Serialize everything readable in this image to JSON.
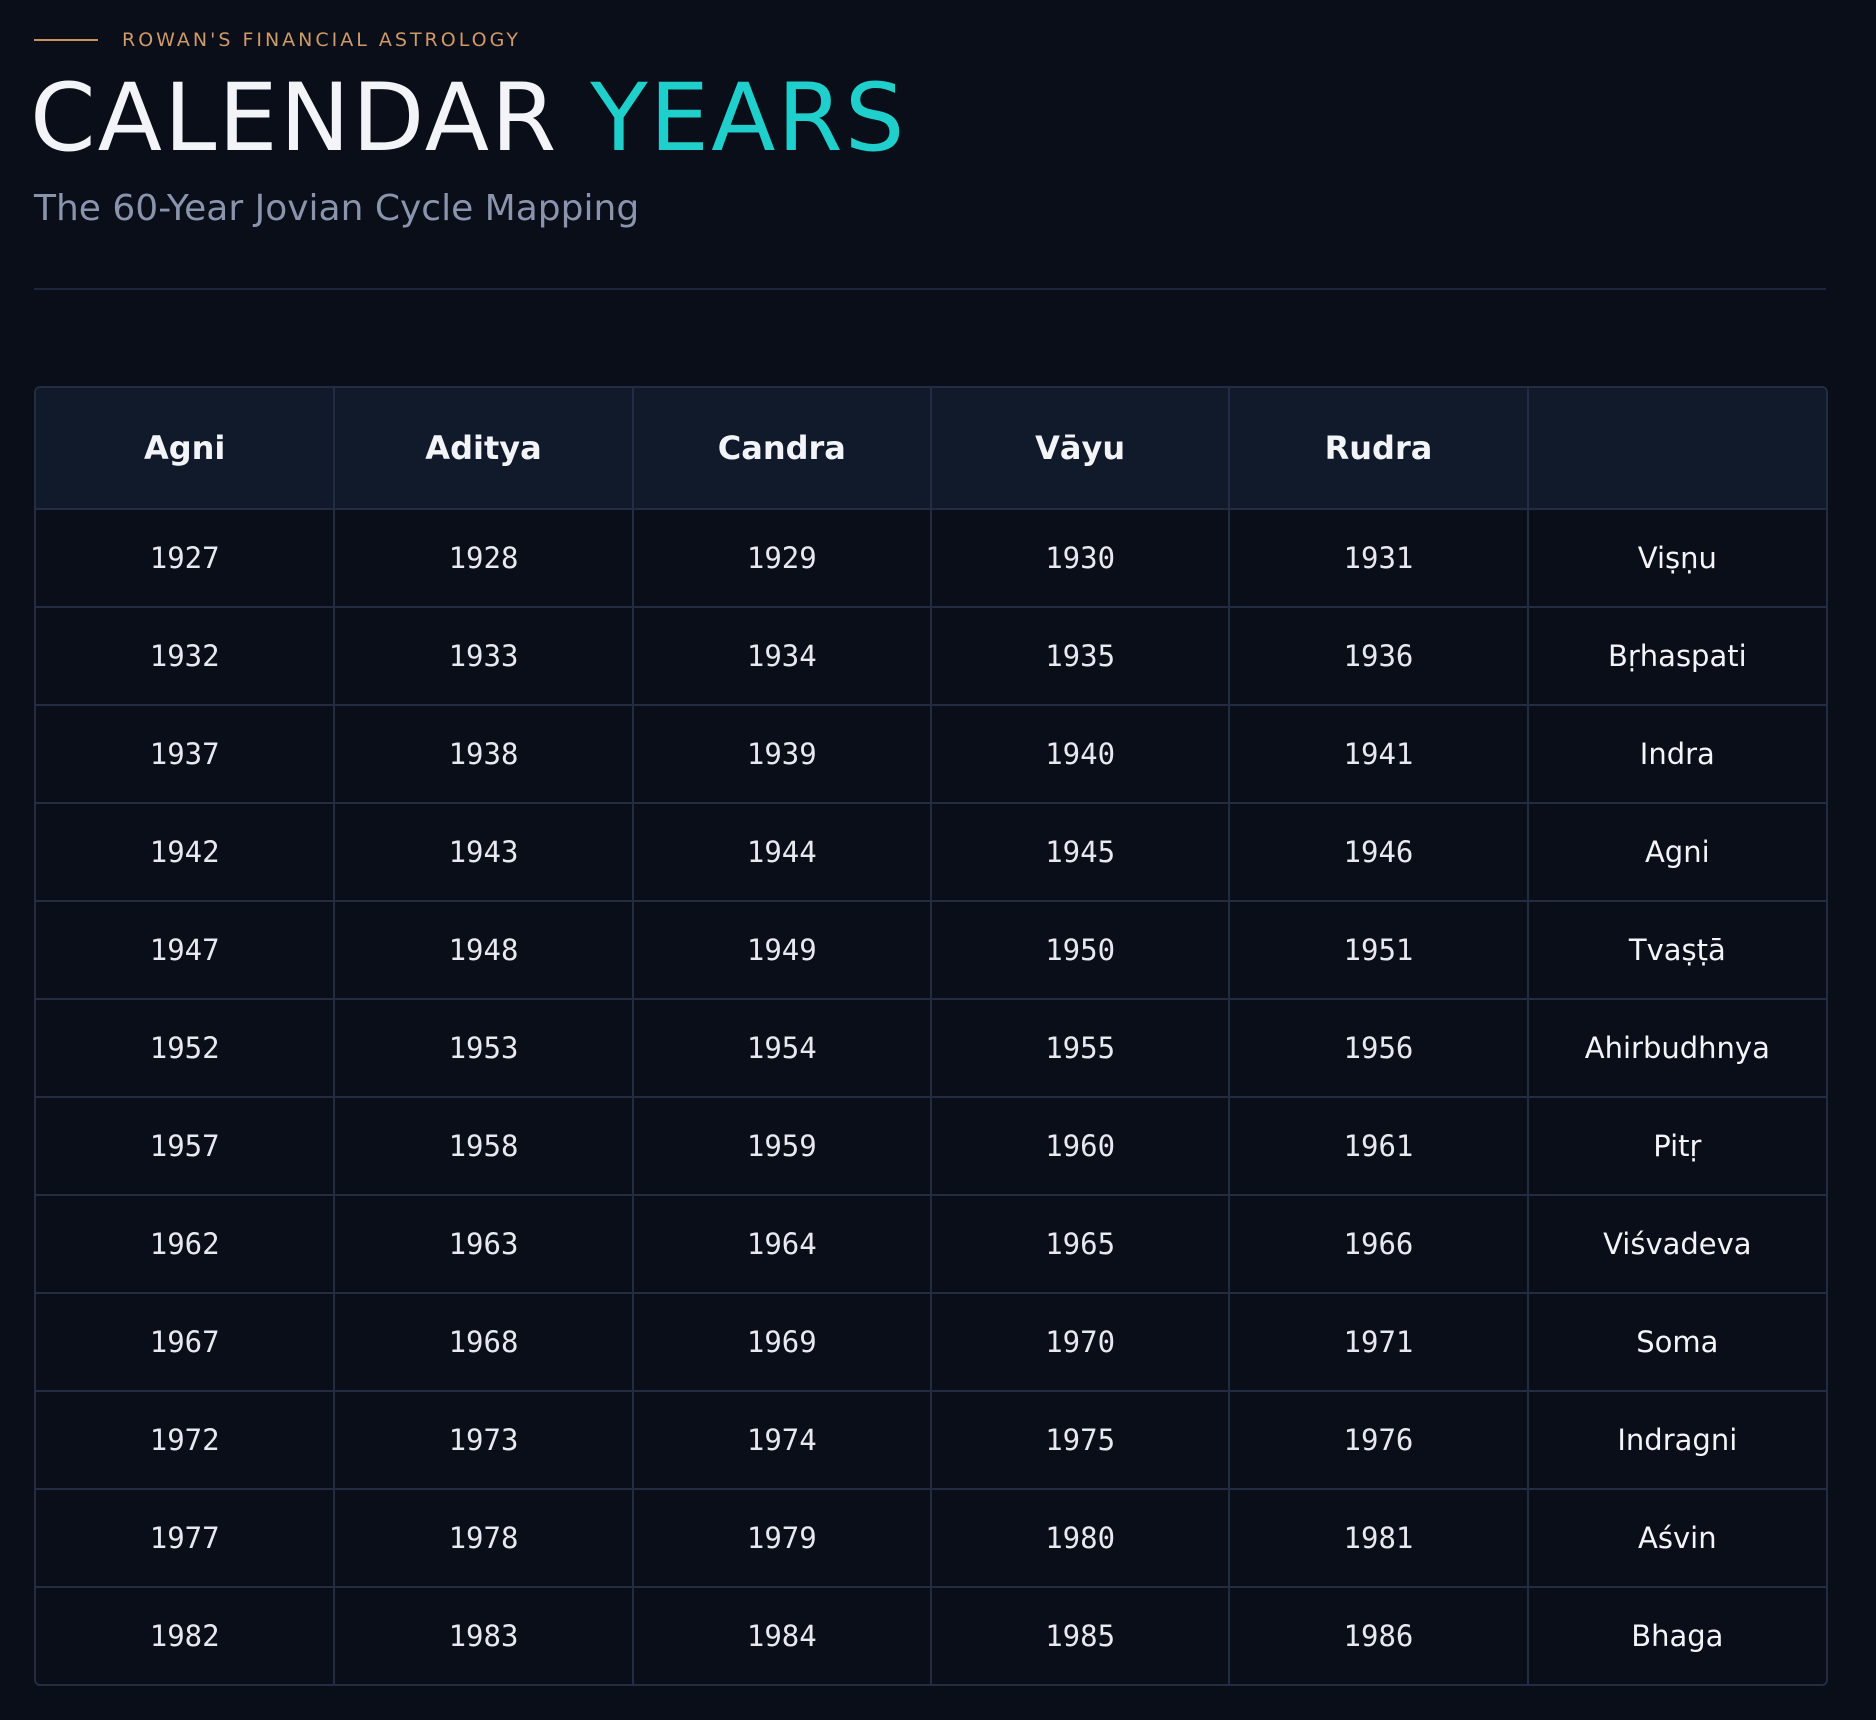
{
  "header": {
    "eyebrow": "ROWAN'S FINANCIAL ASTROLOGY",
    "title_main": "CALENDAR",
    "title_accent": "YEARS",
    "subtitle": "The 60-Year Jovian Cycle Mapping"
  },
  "colors": {
    "background": "#0a0e19",
    "accent": "#1fcfcb",
    "eyebrow": "#cf9a68",
    "subtitle": "#8a94ad",
    "grid": "#222c42",
    "header_row": "#111a2b"
  },
  "table": {
    "columns": [
      "Agni",
      "Aditya",
      "Candra",
      "Vāyu",
      "Rudra",
      ""
    ],
    "rows": [
      [
        "1927",
        "1928",
        "1929",
        "1930",
        "1931",
        "Viṣṇu"
      ],
      [
        "1932",
        "1933",
        "1934",
        "1935",
        "1936",
        "Bṛhaspati"
      ],
      [
        "1937",
        "1938",
        "1939",
        "1940",
        "1941",
        "Indra"
      ],
      [
        "1942",
        "1943",
        "1944",
        "1945",
        "1946",
        "Agni"
      ],
      [
        "1947",
        "1948",
        "1949",
        "1950",
        "1951",
        "Tvaṣṭā"
      ],
      [
        "1952",
        "1953",
        "1954",
        "1955",
        "1956",
        "Ahirbudhnya"
      ],
      [
        "1957",
        "1958",
        "1959",
        "1960",
        "1961",
        "Pitṛ"
      ],
      [
        "1962",
        "1963",
        "1964",
        "1965",
        "1966",
        "Viśvadeva"
      ],
      [
        "1967",
        "1968",
        "1969",
        "1970",
        "1971",
        "Soma"
      ],
      [
        "1972",
        "1973",
        "1974",
        "1975",
        "1976",
        "Indragni"
      ],
      [
        "1977",
        "1978",
        "1979",
        "1980",
        "1981",
        "Aśvin"
      ],
      [
        "1982",
        "1983",
        "1984",
        "1985",
        "1986",
        "Bhaga"
      ]
    ]
  }
}
